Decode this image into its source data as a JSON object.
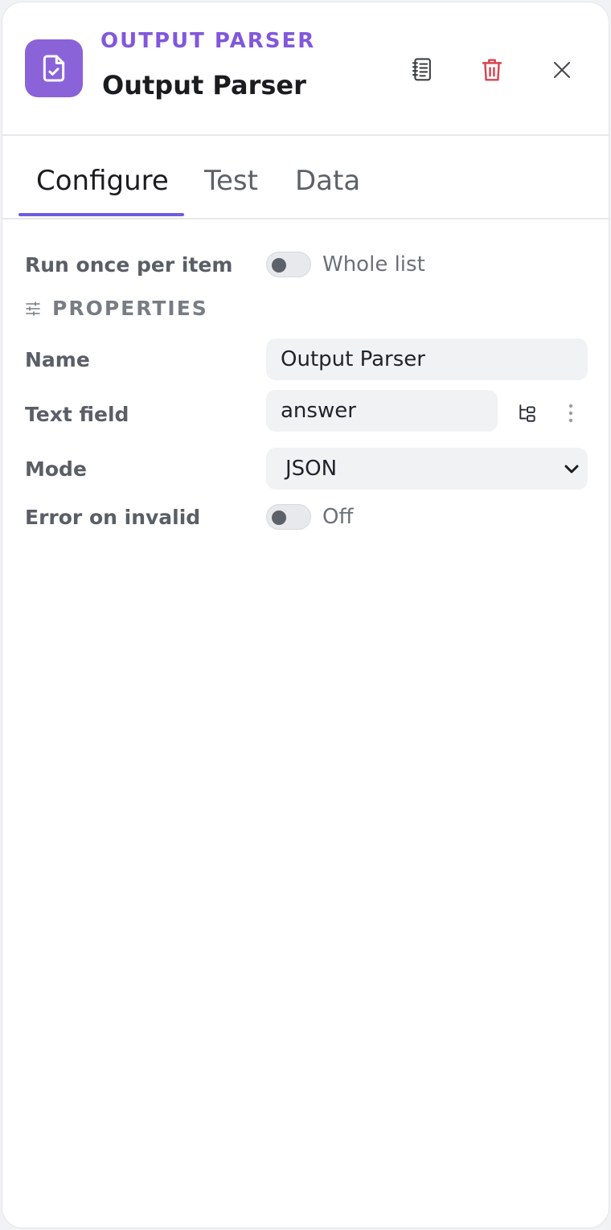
{
  "header": {
    "node_type": "OUTPUT PARSER",
    "node_title": "Output Parser",
    "icon": "file-check-icon",
    "actions": {
      "docs_icon": "notebook-icon",
      "delete_icon": "trash-icon",
      "close_icon": "close-icon"
    }
  },
  "tabs": [
    {
      "label": "Configure",
      "active": true
    },
    {
      "label": "Test",
      "active": false
    },
    {
      "label": "Data",
      "active": false
    }
  ],
  "configure": {
    "run_once": {
      "label": "Run once per item",
      "state": "Whole list",
      "enabled": false
    },
    "section_title": "PROPERTIES",
    "section_icon": "sliders-icon",
    "name": {
      "label": "Name",
      "value": "Output Parser"
    },
    "text_field": {
      "label": "Text field",
      "value": "answer",
      "map_icon": "field-map-icon",
      "more_icon": "more-vertical-icon"
    },
    "mode": {
      "label": "Mode",
      "value": "JSON",
      "chevron_icon": "chevron-down-icon"
    },
    "error_on_invalid": {
      "label": "Error on invalid",
      "state": "Off",
      "enabled": false
    }
  },
  "colors": {
    "accent": "#6d5ce0",
    "node_icon_bg": "#8a63d9",
    "node_type_text": "#8257db",
    "delete": "#d9434f"
  }
}
